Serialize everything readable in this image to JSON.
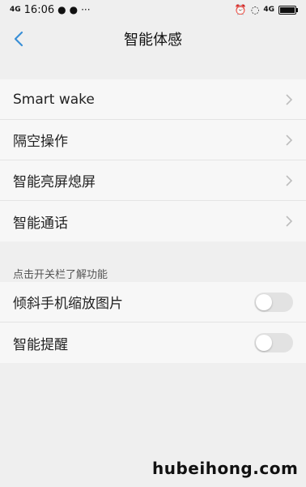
{
  "status_bar": {
    "network": "4G",
    "time": "16:06",
    "icons_left": [
      "message-icon",
      "location-icon",
      "more-icon"
    ],
    "network_right": "4G",
    "icons_right": [
      "alarm-icon",
      "mute-icon",
      "battery-icon"
    ]
  },
  "header": {
    "title": "智能体感"
  },
  "group1": {
    "items": [
      {
        "label": "Smart wake"
      },
      {
        "label": "隔空操作"
      },
      {
        "label": "智能亮屏熄屏"
      },
      {
        "label": "智能通话"
      }
    ]
  },
  "section_label": "点击开关栏了解功能",
  "group2": {
    "items": [
      {
        "label": "倾斜手机缩放图片",
        "enabled": false
      },
      {
        "label": "智能提醒",
        "enabled": false
      }
    ]
  },
  "watermark": "hubeihong.com",
  "colors": {
    "accent": "#3a8fd6",
    "page_bg": "#efefef",
    "row_bg": "#f7f7f7"
  }
}
